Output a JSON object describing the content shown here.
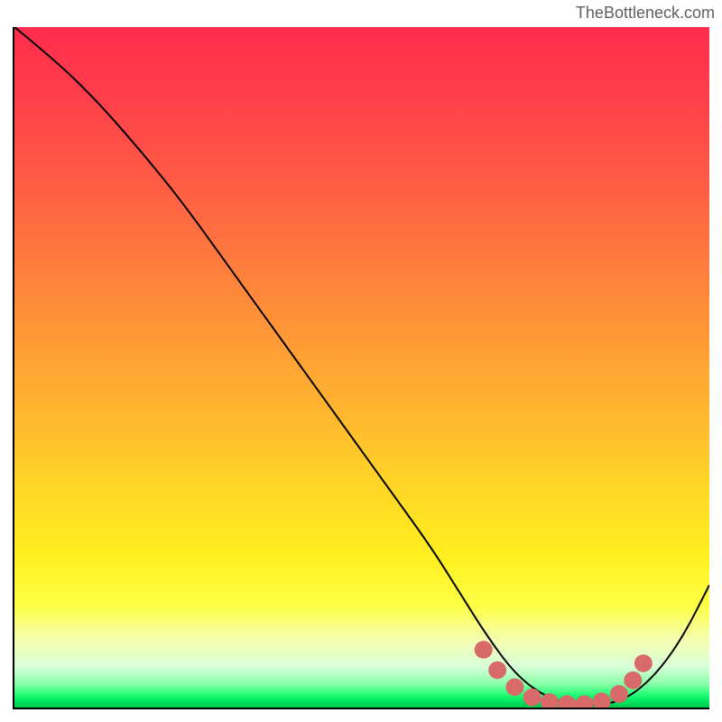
{
  "attribution": "TheBottleneck.com",
  "chart_data": {
    "type": "line",
    "title": "",
    "xlabel": "",
    "ylabel": "",
    "xlim": [
      0,
      100
    ],
    "ylim": [
      0,
      100
    ],
    "series": [
      {
        "name": "bottleneck-curve",
        "x": [
          0,
          6,
          12,
          18,
          24,
          30,
          36,
          42,
          48,
          54,
          60,
          64,
          68,
          72,
          76,
          80,
          84,
          88,
          92,
          96,
          100
        ],
        "y": [
          100,
          95,
          89,
          82,
          74.5,
          66,
          57.5,
          49,
          40.5,
          32,
          23.5,
          17,
          10.5,
          5,
          1.8,
          0.4,
          0.3,
          1.2,
          4.5,
          10,
          18
        ]
      }
    ],
    "highlight_cluster": {
      "name": "optimal-range-dots",
      "color": "#d86a6a",
      "points": [
        {
          "x": 67.5,
          "y": 8.5
        },
        {
          "x": 69.5,
          "y": 5.5
        },
        {
          "x": 72.0,
          "y": 3.0
        },
        {
          "x": 74.5,
          "y": 1.5
        },
        {
          "x": 77.0,
          "y": 0.8
        },
        {
          "x": 79.5,
          "y": 0.5
        },
        {
          "x": 82.0,
          "y": 0.5
        },
        {
          "x": 84.5,
          "y": 0.9
        },
        {
          "x": 87.0,
          "y": 2.0
        },
        {
          "x": 89.0,
          "y": 4.0
        },
        {
          "x": 90.5,
          "y": 6.5
        }
      ]
    }
  }
}
